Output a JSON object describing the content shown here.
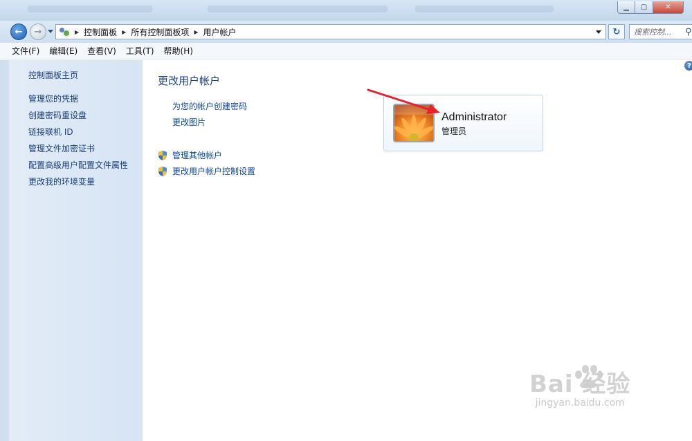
{
  "window": {
    "controls": {
      "minimize_icon": "minimize-icon",
      "maximize_icon": "maximize-icon",
      "close_icon": "close-icon"
    }
  },
  "address_bar": {
    "crumbs": [
      "控制面板",
      "所有控制面板项",
      "用户帐户"
    ],
    "search_placeholder": "搜索控制..."
  },
  "menu": [
    "文件(F)",
    "编辑(E)",
    "查看(V)",
    "工具(T)",
    "帮助(H)"
  ],
  "sidebar": {
    "home": "控制面板主页",
    "items": [
      "管理您的凭据",
      "创建密码重设盘",
      "链接联机 ID",
      "管理文件加密证书",
      "配置高级用户配置文件属性",
      "更改我的环境变量"
    ]
  },
  "main": {
    "title": "更改用户帐户",
    "tasks": [
      "为您的帐户创建密码",
      "更改图片"
    ],
    "admin_tasks": [
      "管理其他帐户",
      "更改用户帐户控制设置"
    ]
  },
  "account": {
    "name": "Administrator",
    "role": "管理员"
  },
  "watermark": {
    "logo": "Bai 经验",
    "url": "jingyan.baidu.com"
  },
  "colors": {
    "link": "#0b47a8",
    "title": "#1e3f85",
    "annotation_arrow": "#e8202a"
  }
}
